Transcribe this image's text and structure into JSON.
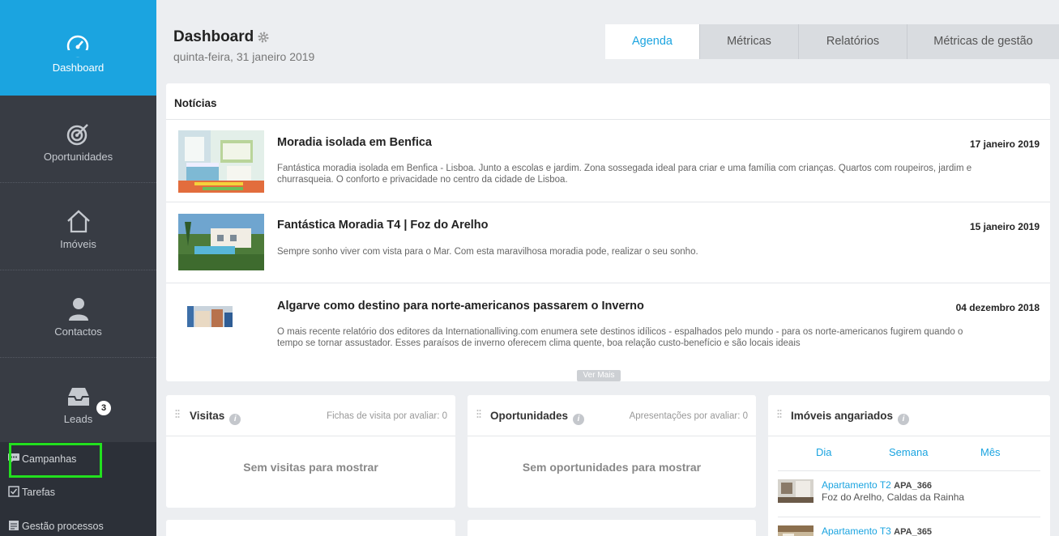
{
  "sidebar": {
    "dashboard": "Dashboard",
    "oportunidades": "Oportunidades",
    "imoveis": "Imóveis",
    "contactos": "Contactos",
    "leads": "Leads",
    "leads_badge": "3",
    "campanhas": "Campanhas",
    "tarefas": "Tarefas",
    "gestao": "Gestão processos"
  },
  "header": {
    "title": "Dashboard",
    "date": "quinta-feira, 31 janeiro 2019",
    "tabs": [
      "Agenda",
      "Métricas",
      "Relatórios",
      "Métricas de gestão"
    ]
  },
  "news": {
    "heading": "Notícias",
    "items": [
      {
        "title": "Moradia isolada em Benfica",
        "date": "17 janeiro 2019",
        "desc": "Fantástica moradia isolada em Benfica - Lisboa. Junto a escolas e jardim. Zona sossegada ideal para criar e uma família com crianças. Quartos com roupeiros, jardim e churrasqueia. O conforto e privacidade no centro da cidade de Lisboa."
      },
      {
        "title": "Fantástica Moradia T4 | Foz do Arelho",
        "date": "15 janeiro 2019",
        "desc": "Sempre sonho viver com vista para o Mar. Com esta maravilhosa moradia pode, realizar o seu sonho."
      },
      {
        "title": "Algarve como destino para norte-americanos passarem o Inverno",
        "date": "04 dezembro 2018",
        "desc": "O mais recente relatório dos editores da Internationalliving.com enumera sete destinos idílicos - espalhados pelo mundo - para os norte-americanos fugirem quando o tempo se tornar assustador. Esses paraísos de inverno oferecem clima quente, boa relação custo-benefício e são locais ideais"
      }
    ],
    "more": "Ver Mais"
  },
  "visitas": {
    "title": "Visitas",
    "sub": "Fichas de visita por avaliar: 0",
    "empty": "Sem visitas para mostrar"
  },
  "oportunidades": {
    "title": "Oportunidades",
    "sub": "Apresentações por avaliar: 0",
    "empty": "Sem oportunidades para mostrar"
  },
  "angariados": {
    "title": "Imóveis angariados",
    "periods": [
      "Dia",
      "Semana",
      "Mês"
    ],
    "items": [
      {
        "name": "Apartamento T2",
        "ref": "APA_366",
        "loc": "Foz do Arelho, Caldas da Rainha"
      },
      {
        "name": "Apartamento T3",
        "ref": "APA_365",
        "loc": ""
      }
    ]
  },
  "colors": {
    "accent": "#1ba4e0",
    "sidebar": "#383c44",
    "highlight": "#22e01e"
  }
}
